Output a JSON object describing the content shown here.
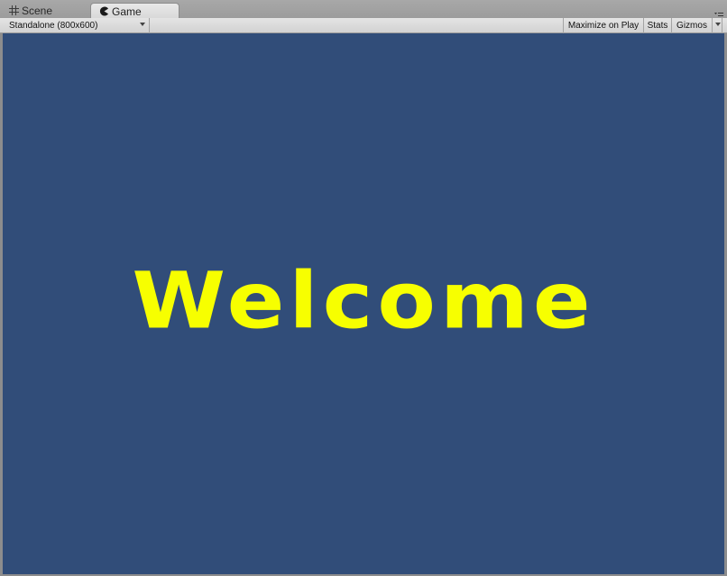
{
  "tabs": [
    {
      "label": "Scene",
      "icon": "grid-icon",
      "active": false
    },
    {
      "label": "Game",
      "icon": "pacman-icon",
      "active": true
    }
  ],
  "toolbar": {
    "resolution": "Standalone (800x600)",
    "maximize_on_play": "Maximize on Play",
    "stats": "Stats",
    "gizmos": "Gizmos"
  },
  "game": {
    "background_color": "#314d79",
    "title_text": "Welcome",
    "title_color": "#f7ff00"
  }
}
